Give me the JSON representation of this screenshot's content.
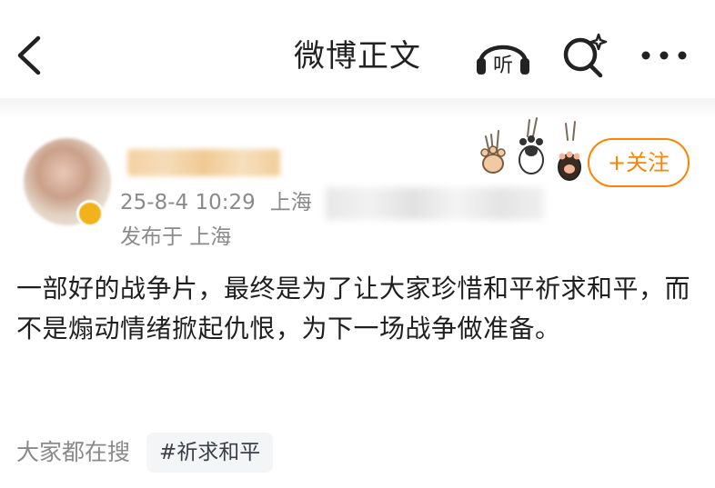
{
  "nav": {
    "title": "微博正文",
    "listen_label": "听"
  },
  "author": {
    "date": "25-8-4 10:29",
    "ip_prefix": "上海",
    "location": "发布于 上海",
    "follow_label": "+关注"
  },
  "post": {
    "text": "一部好的战争片，最终是为了让大家珍惜和平祈求和平，而不是煽动情绪掀起仇恨，为下一场战争做准备。"
  },
  "search": {
    "label": "大家都在搜",
    "tag": "#祈求和平"
  },
  "colors": {
    "accent": "#ff8200",
    "meta_text": "#8a8a8a",
    "tag_bg": "#f4f5f7"
  },
  "icons": {
    "back": "chevron-left-icon",
    "listen": "headphones-icon",
    "search": "search-sparkle-icon",
    "more": "more-dots-icon",
    "decor": "cat-paw-icon"
  }
}
